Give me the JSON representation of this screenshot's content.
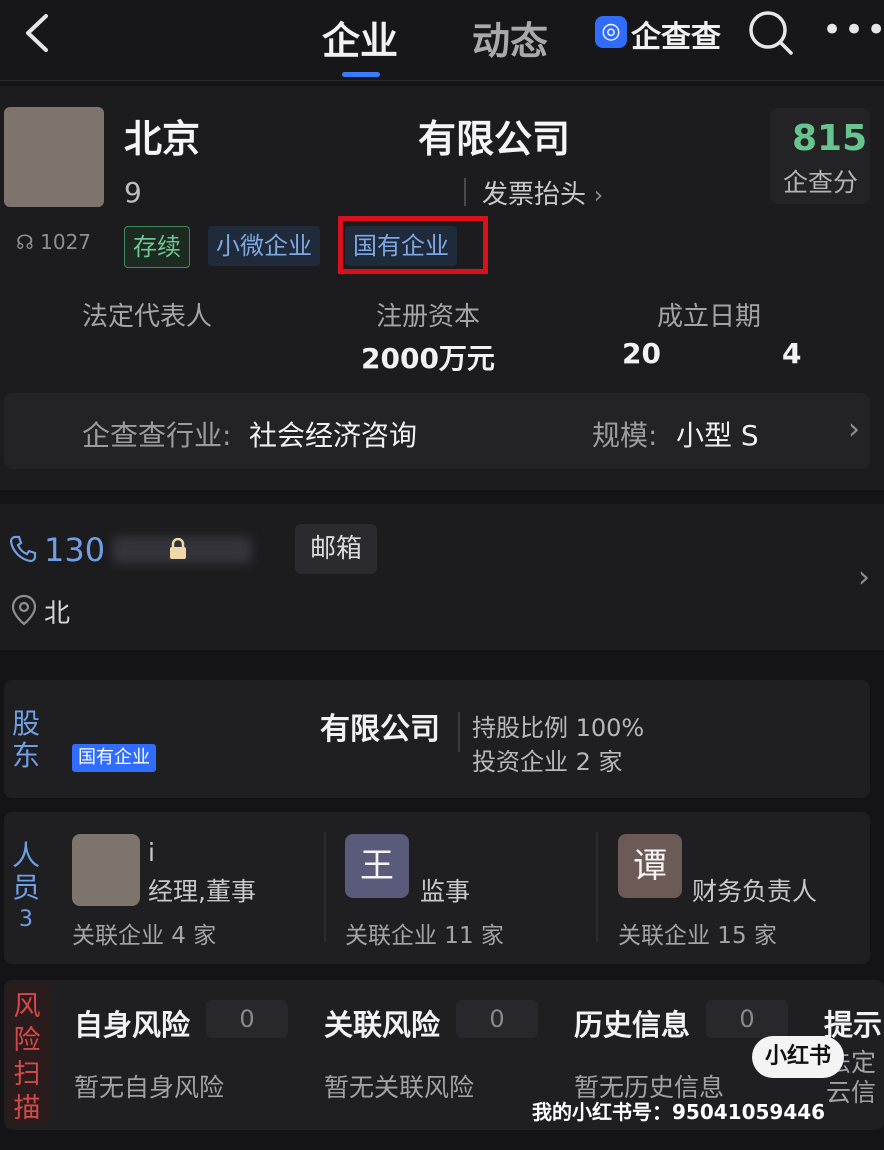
{
  "nav": {
    "tab_enterprise": "企业",
    "tab_dynamics": "动态",
    "brand": "企查查",
    "accent": "#3b7cff"
  },
  "company": {
    "name_left": "北京",
    "name_right": "有限公司",
    "code_partial": "9",
    "invoice_link": "发票抬头",
    "score": "815",
    "score_label": "企查分",
    "views": "1027",
    "tags": [
      "存续",
      "小微企业",
      "国有企业"
    ],
    "legal_rep_label": "法定代表人",
    "capital_label": "注册资本",
    "capital_value": "2000万元",
    "founded_label": "成立日期",
    "founded_a": "20",
    "founded_b": "4",
    "industry_label": "企查查行业:",
    "industry_value": "社会经济咨询",
    "scale_label": "规模:",
    "scale_value": "小型 S"
  },
  "contact": {
    "phone_prefix": "130",
    "email_label": "邮箱",
    "address_partial": "北"
  },
  "shareholder": {
    "section_chars": [
      "股",
      "东"
    ],
    "name": "有限公司",
    "badge": "国有企业",
    "ratio_line": "持股比例 100%",
    "invest_line": "投资企业 2 家"
  },
  "people": {
    "section_chars": [
      "人",
      "员"
    ],
    "count": "3",
    "members": [
      {
        "avatar_text": "",
        "name_partial": "i",
        "role": "经理,董事",
        "assoc": "关联企业 4 家"
      },
      {
        "avatar_text": "王",
        "role": "监事",
        "assoc": "关联企业 11 家"
      },
      {
        "avatar_text": "谭",
        "role": "财务负责人",
        "assoc": "关联企业 15 家"
      }
    ]
  },
  "risk": {
    "section_chars": [
      "风",
      "险",
      "扫",
      "描"
    ],
    "items": [
      {
        "title": "自身风险",
        "count": "0",
        "desc": "暂无自身风险"
      },
      {
        "title": "关联风险",
        "count": "0",
        "desc": "暂无关联风险"
      },
      {
        "title": "历史信息",
        "count": "0",
        "desc": "暂无历史信息"
      },
      {
        "title": "提示",
        "desc": "法定\n云信"
      }
    ]
  },
  "watermark": {
    "badge": "小红书",
    "text": "我的小红书号：95041059446"
  }
}
